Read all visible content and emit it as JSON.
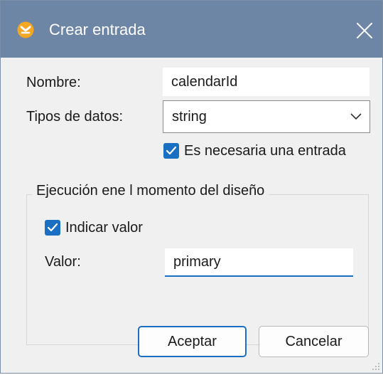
{
  "window": {
    "title": "Crear entrada",
    "icon": "app-logo-icon",
    "close_icon": "close-icon"
  },
  "form": {
    "name_label": "Nombre:",
    "name_value": "calendarId",
    "type_label": "Tipos de datos:",
    "type_value": "string",
    "required_label": "Es necesaria una entrada",
    "required_checked": true
  },
  "design_time": {
    "group_title": "Ejecución ene l momento del diseño",
    "specify_label": "Indicar valor",
    "specify_checked": true,
    "value_label": "Valor:",
    "value": "primary"
  },
  "buttons": {
    "ok": "Aceptar",
    "cancel": "Cancelar"
  },
  "colors": {
    "titlebar": "#6e86a5",
    "accent": "#1a6fc2",
    "background": "#f0f0f0"
  }
}
